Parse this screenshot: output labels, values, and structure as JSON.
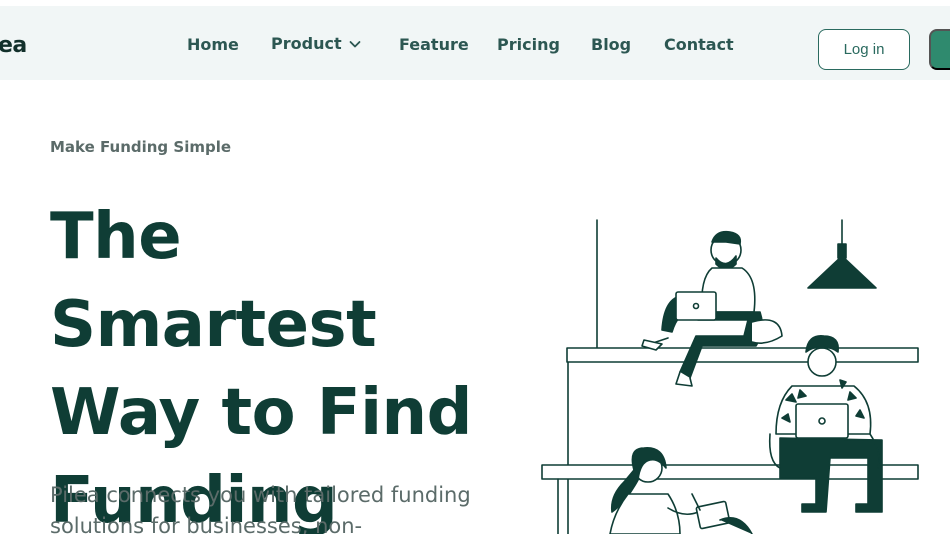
{
  "brand": {
    "logo_text": "ea"
  },
  "nav": {
    "items": [
      {
        "label": "Home"
      },
      {
        "label": "Product"
      },
      {
        "label": "Feature"
      },
      {
        "label": "Pricing"
      },
      {
        "label": "Blog"
      },
      {
        "label": "Contact"
      }
    ],
    "product_icon": "chevron-down-icon",
    "login_label": "Log in"
  },
  "hero": {
    "eyebrow": "Make Funding Simple",
    "headline_lines": [
      "The Smartest",
      "Way to Find",
      "Funding"
    ],
    "subtext": "Pilea connects you with tailored funding solutions for businesses, non-"
  },
  "colors": {
    "accent": "#0f3d35",
    "nav_background": "#f1f6f6",
    "button_primary": "#2f8a6e",
    "button_border": "#2a6a5f",
    "muted_text": "#5b6b69"
  }
}
